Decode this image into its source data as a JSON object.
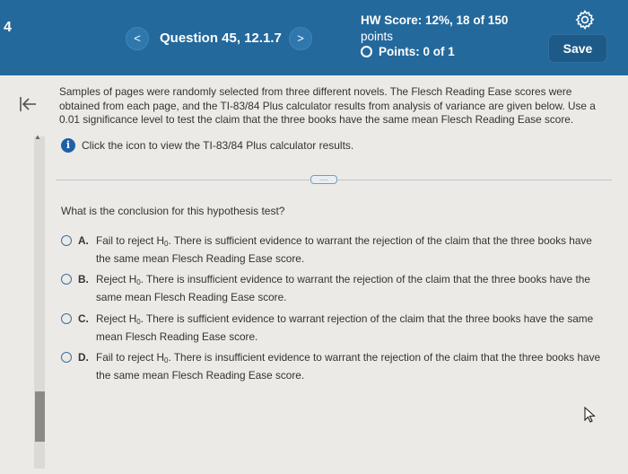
{
  "header": {
    "question_number": "4",
    "prev_label": "<",
    "next_label": ">",
    "question_title": "Question 45, 12.1.7",
    "hw_score_label": "HW Score:",
    "hw_score_value": "12%, 18 of 150",
    "hw_score_suffix": "points",
    "points_text": "Points: 0 of 1",
    "save_label": "Save",
    "brand_color": "#24699c"
  },
  "problem": {
    "text": "Samples of pages were randomly selected from three different novels. The Flesch Reading Ease scores were obtained from each page, and the TI-83/84 Plus calculator results from analysis of variance are given below. Use a 0.01 significance level to test the claim that the three books have the same mean Flesch Reading Ease score.",
    "info_text": "Click the icon to view the TI-83/84 Plus calculator results.",
    "expand_label": "....."
  },
  "question": {
    "prompt": "What is the conclusion for this hypothesis test?",
    "options": [
      {
        "letter": "A.",
        "pre": "Fail to reject H",
        "sub": "0",
        "post": ". There is sufficient evidence to warrant the rejection of the claim that the three books have the same mean Flesch Reading Ease score."
      },
      {
        "letter": "B.",
        "pre": "Reject H",
        "sub": "0",
        "post": ". There is insufficient evidence to warrant the rejection of the claim that the three books have the same mean Flesch Reading Ease score."
      },
      {
        "letter": "C.",
        "pre": "Reject H",
        "sub": "0",
        "post": ". There is sufficient evidence to warrant rejection of the claim that the three books have the same mean Flesch Reading Ease score."
      },
      {
        "letter": "D.",
        "pre": "Fail to reject H",
        "sub": "0",
        "post": ". There is insufficient evidence to warrant the rejection of the claim that the three books have the same mean Flesch Reading Ease score."
      }
    ]
  },
  "icons": {
    "settings": "gear-icon",
    "collapse": "collapse-left-icon",
    "info": "info-icon",
    "status": "circle-icon",
    "cursor": "mouse-pointer-icon"
  }
}
